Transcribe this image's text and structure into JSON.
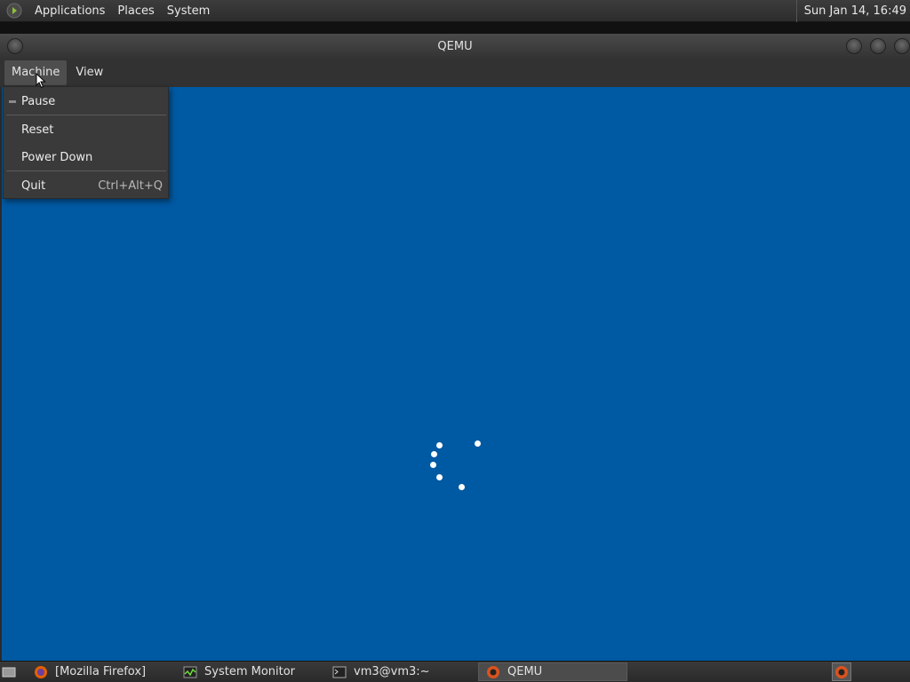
{
  "top_panel": {
    "menus": [
      "Applications",
      "Places",
      "System"
    ],
    "clock": "Sun Jan 14, 16:49"
  },
  "window": {
    "title": "QEMU",
    "menubar": [
      "Machine",
      "View"
    ],
    "active_menu": "Machine"
  },
  "machine_menu": {
    "items": [
      {
        "label": "Pause",
        "shortcut": ""
      },
      {
        "label": "Reset",
        "shortcut": ""
      },
      {
        "label": "Power Down",
        "shortcut": ""
      },
      {
        "label": "Quit",
        "shortcut": "Ctrl+Alt+Q"
      }
    ]
  },
  "vm_screen": {
    "background_color": "#0059a3",
    "state": "loading-spinner"
  },
  "taskbar": {
    "tasks": [
      {
        "label": "[Mozilla Firefox]",
        "icon": "firefox-icon",
        "active": false
      },
      {
        "label": "System Monitor",
        "icon": "system-monitor-icon",
        "active": false
      },
      {
        "label": "vm3@vm3:~",
        "icon": "terminal-icon",
        "active": false
      },
      {
        "label": "QEMU",
        "icon": "qemu-icon",
        "active": true
      }
    ]
  },
  "colors": {
    "accent": "#0059a3",
    "panel": "#2c2c2c",
    "menu": "#3a3a3a"
  }
}
